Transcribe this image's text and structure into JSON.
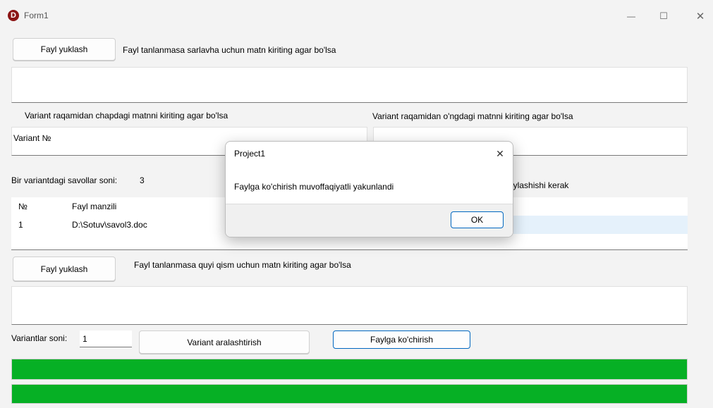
{
  "window": {
    "title": "Form1",
    "icon_letter": "D",
    "minimize_glyph": "—",
    "maximize_glyph": "☐",
    "close_glyph": "✕"
  },
  "header_section": {
    "load_button": "Fayl yuklash",
    "label": "Fayl tanlanmasa sarlavha uchun matn kiriting agar bo'lsa",
    "text": ""
  },
  "variant_left": {
    "label": "Variant raqamidan chapdagi matnni kiriting agar bo'lsa",
    "value": "Variant №"
  },
  "variant_right": {
    "label": "Variant raqamidan o'ngdagi matnni kiriting agar bo'lsa",
    "value": ""
  },
  "questions": {
    "label": "Bir variantdagi savollar soni:",
    "count": "3",
    "right_label_partial": "oylashishi kerak"
  },
  "grid": {
    "columns": [
      "№",
      "Fayl manzili"
    ],
    "rows": [
      [
        "1",
        "D:\\Sotuv\\savol3.doc"
      ]
    ]
  },
  "footer_section": {
    "load_button": "Fayl yuklash",
    "label": "Fayl tanlanmasa quyi qism uchun matn kiriting agar bo'lsa",
    "text": ""
  },
  "controls": {
    "variants_label": "Variantlar soni:",
    "variants_value": "1",
    "shuffle_button": "Variant aralashtirish",
    "export_button": "Faylga ko'chirish"
  },
  "progress": [
    {
      "value_percent": 100,
      "color": "#06b025"
    },
    {
      "value_percent": 100,
      "color": "#06b025"
    }
  ],
  "dialog": {
    "title": "Project1",
    "message": "Faylga ko'chirish muvoffaqiyatli yakunlandi",
    "ok_button": "OK",
    "close_glyph": "✕"
  }
}
